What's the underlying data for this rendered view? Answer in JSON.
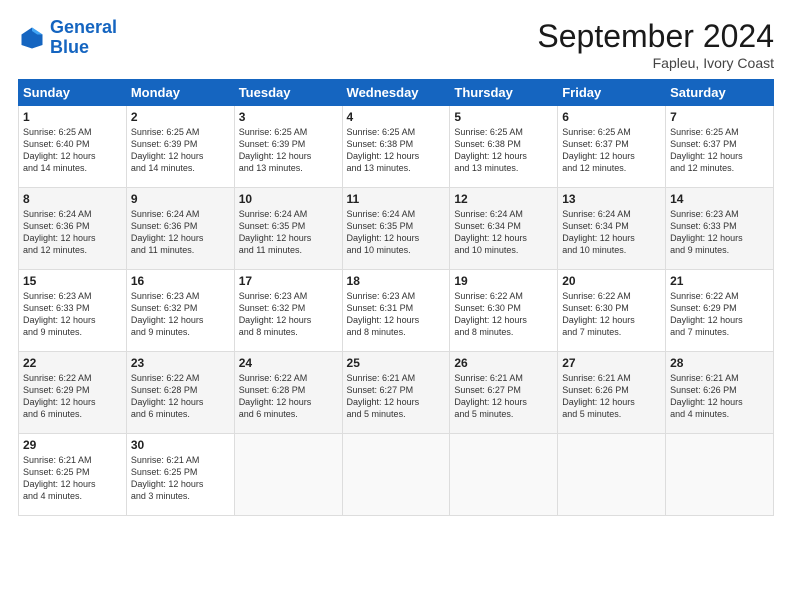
{
  "header": {
    "logo_general": "General",
    "logo_blue": "Blue",
    "month_title": "September 2024",
    "location": "Fapleu, Ivory Coast"
  },
  "weekdays": [
    "Sunday",
    "Monday",
    "Tuesday",
    "Wednesday",
    "Thursday",
    "Friday",
    "Saturday"
  ],
  "weeks": [
    [
      {
        "day": "1",
        "sunrise": "6:25 AM",
        "sunset": "6:40 PM",
        "daylight": "12 hours and 14 minutes."
      },
      {
        "day": "2",
        "sunrise": "6:25 AM",
        "sunset": "6:39 PM",
        "daylight": "12 hours and 14 minutes."
      },
      {
        "day": "3",
        "sunrise": "6:25 AM",
        "sunset": "6:39 PM",
        "daylight": "12 hours and 13 minutes."
      },
      {
        "day": "4",
        "sunrise": "6:25 AM",
        "sunset": "6:38 PM",
        "daylight": "12 hours and 13 minutes."
      },
      {
        "day": "5",
        "sunrise": "6:25 AM",
        "sunset": "6:38 PM",
        "daylight": "12 hours and 13 minutes."
      },
      {
        "day": "6",
        "sunrise": "6:25 AM",
        "sunset": "6:37 PM",
        "daylight": "12 hours and 12 minutes."
      },
      {
        "day": "7",
        "sunrise": "6:25 AM",
        "sunset": "6:37 PM",
        "daylight": "12 hours and 12 minutes."
      }
    ],
    [
      {
        "day": "8",
        "sunrise": "6:24 AM",
        "sunset": "6:36 PM",
        "daylight": "12 hours and 12 minutes."
      },
      {
        "day": "9",
        "sunrise": "6:24 AM",
        "sunset": "6:36 PM",
        "daylight": "12 hours and 11 minutes."
      },
      {
        "day": "10",
        "sunrise": "6:24 AM",
        "sunset": "6:35 PM",
        "daylight": "12 hours and 11 minutes."
      },
      {
        "day": "11",
        "sunrise": "6:24 AM",
        "sunset": "6:35 PM",
        "daylight": "12 hours and 10 minutes."
      },
      {
        "day": "12",
        "sunrise": "6:24 AM",
        "sunset": "6:34 PM",
        "daylight": "12 hours and 10 minutes."
      },
      {
        "day": "13",
        "sunrise": "6:24 AM",
        "sunset": "6:34 PM",
        "daylight": "12 hours and 10 minutes."
      },
      {
        "day": "14",
        "sunrise": "6:23 AM",
        "sunset": "6:33 PM",
        "daylight": "12 hours and 9 minutes."
      }
    ],
    [
      {
        "day": "15",
        "sunrise": "6:23 AM",
        "sunset": "6:33 PM",
        "daylight": "12 hours and 9 minutes."
      },
      {
        "day": "16",
        "sunrise": "6:23 AM",
        "sunset": "6:32 PM",
        "daylight": "12 hours and 9 minutes."
      },
      {
        "day": "17",
        "sunrise": "6:23 AM",
        "sunset": "6:32 PM",
        "daylight": "12 hours and 8 minutes."
      },
      {
        "day": "18",
        "sunrise": "6:23 AM",
        "sunset": "6:31 PM",
        "daylight": "12 hours and 8 minutes."
      },
      {
        "day": "19",
        "sunrise": "6:22 AM",
        "sunset": "6:30 PM",
        "daylight": "12 hours and 8 minutes."
      },
      {
        "day": "20",
        "sunrise": "6:22 AM",
        "sunset": "6:30 PM",
        "daylight": "12 hours and 7 minutes."
      },
      {
        "day": "21",
        "sunrise": "6:22 AM",
        "sunset": "6:29 PM",
        "daylight": "12 hours and 7 minutes."
      }
    ],
    [
      {
        "day": "22",
        "sunrise": "6:22 AM",
        "sunset": "6:29 PM",
        "daylight": "12 hours and 6 minutes."
      },
      {
        "day": "23",
        "sunrise": "6:22 AM",
        "sunset": "6:28 PM",
        "daylight": "12 hours and 6 minutes."
      },
      {
        "day": "24",
        "sunrise": "6:22 AM",
        "sunset": "6:28 PM",
        "daylight": "12 hours and 6 minutes."
      },
      {
        "day": "25",
        "sunrise": "6:21 AM",
        "sunset": "6:27 PM",
        "daylight": "12 hours and 5 minutes."
      },
      {
        "day": "26",
        "sunrise": "6:21 AM",
        "sunset": "6:27 PM",
        "daylight": "12 hours and 5 minutes."
      },
      {
        "day": "27",
        "sunrise": "6:21 AM",
        "sunset": "6:26 PM",
        "daylight": "12 hours and 5 minutes."
      },
      {
        "day": "28",
        "sunrise": "6:21 AM",
        "sunset": "6:26 PM",
        "daylight": "12 hours and 4 minutes."
      }
    ],
    [
      {
        "day": "29",
        "sunrise": "6:21 AM",
        "sunset": "6:25 PM",
        "daylight": "12 hours and 4 minutes."
      },
      {
        "day": "30",
        "sunrise": "6:21 AM",
        "sunset": "6:25 PM",
        "daylight": "12 hours and 3 minutes."
      },
      null,
      null,
      null,
      null,
      null
    ]
  ]
}
